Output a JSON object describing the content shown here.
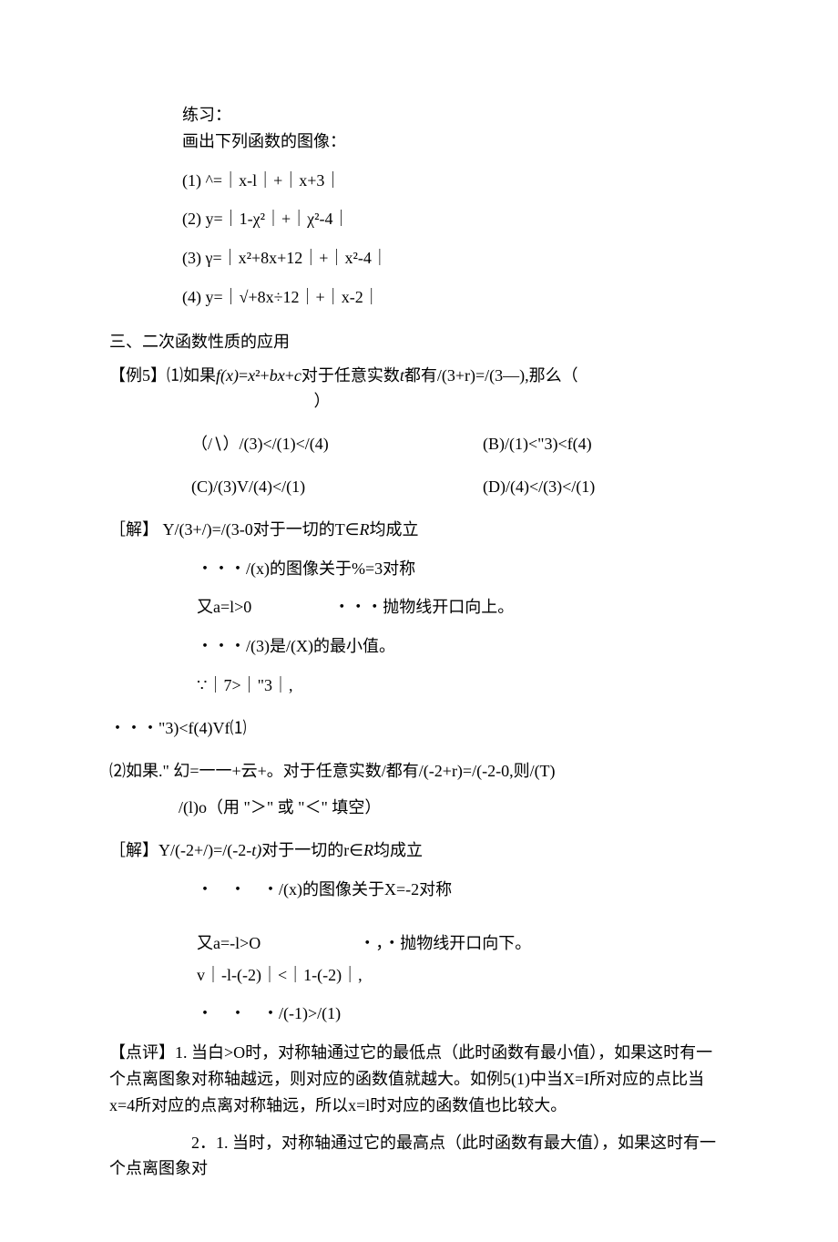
{
  "practice": {
    "title": "练习：",
    "prompt": "画出下列函数的图像：",
    "items": [
      "(1)   ^=｜x-l｜+｜x+3｜",
      "(2)   y=｜1-χ²｜+｜χ²-4｜",
      "(3)   γ=｜x²+8x+12｜+｜x²-4｜",
      "(4)   y=｜√+8x÷12｜+｜x-2｜"
    ]
  },
  "section_heading": "三、二次函数性质的应用",
  "example5": {
    "q1_intro": "【例5】⑴如果<span class='ital'>f(x)</span>=<span class='ital'>x</span>²+<span class='ital'>bx</span>+<span class='ital'>c</span>对于任意实数<span class='ital'>t</span>都有/(3+r)=/(3—),那么（",
    "q1_close": "）",
    "options": {
      "A": "（/∖）/(3)</(1)</(4)",
      "B": "(B)/(1)<\"3)<f(4)",
      "C": "(C)/(3)V/(4)</(1)",
      "D": "(D)/(4)</(3)</(1)"
    },
    "sol1": {
      "label": "［解】  Y/(3+/)=/(3-0对于一切的T∈<span class='ital'>R</span>均成立",
      "lines": [
        "・・・/(x)的图像关于%=3对称",
        "又a=l>0　　　　　・・・抛物线开口向上。",
        "・・・/(3)是/(X)的最小值。",
        "∵｜7>｜\"3｜,"
      ],
      "conclusion": "・・・\"3)<f(4)Vf⑴"
    },
    "q2_intro": "⑵如果.\" 幻=一一+云+。对于任意实数/都有/(-2+r)=/(-2-0,则/(T)",
    "q2_fill": "　　/(l)o（用 \"＞\" 或 \"＜\" 填空）",
    "sol2": {
      "label": "［解】Y/(-2+/)=/(-2-<span class='ital'>t)</span>对于一切的r∈<span class='ital'>R</span>均成立",
      "lines": [
        "・　・　・/(x)的图像关于X=-2对称",
        "又a=-l>O　　　　　　・，・抛物线开口向下。",
        "v｜-l-(-2)｜<｜1-(-2)｜,",
        "・　・　・/(-1)>/(1)"
      ]
    }
  },
  "comment": {
    "p1": "【点评】1. 当白>O时，对称轴通过它的最低点（此时函数有最小值），如果这时有一个点离图象对称轴越远，则对应的函数值就越大。如例5(1)中当X=I所对应的点比当x=4所对应的点离对称轴远，所以x=l时对应的函数值也比较大。",
    "p2": "　　　　　2．1. 当时，对称轴通过它的最高点（此时函数有最大值），如果这时有一个点离图象对"
  }
}
